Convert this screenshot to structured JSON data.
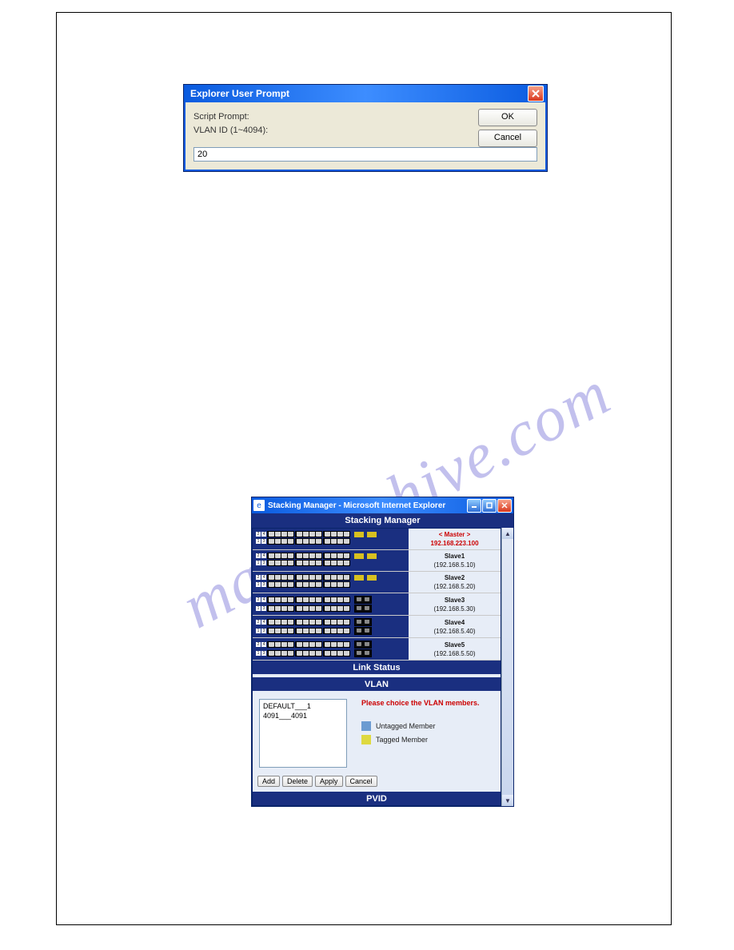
{
  "prompt": {
    "title": "Explorer User Prompt",
    "line1": "Script Prompt:",
    "line2": "VLAN ID (1~4094):",
    "ok": "OK",
    "cancel": "Cancel",
    "value": "20"
  },
  "stacking": {
    "window_title": "Stacking Manager - Microsoft Internet Explorer",
    "header": "Stacking Manager",
    "link_status": "Link Status",
    "vlan_header": "VLAN",
    "pvid_header": "PVID",
    "switches": [
      {
        "name": "< Master >",
        "ip": "192.168.223.100",
        "master": true,
        "sfp": true
      },
      {
        "name": "Slave1",
        "ip": "(192.168.5.10)",
        "master": false,
        "sfp": true
      },
      {
        "name": "Slave2",
        "ip": "(192.168.5.20)",
        "master": false,
        "sfp": true
      },
      {
        "name": "Slave3",
        "ip": "(192.168.5.30)",
        "master": false,
        "sfp": false
      },
      {
        "name": "Slave4",
        "ip": "(192.168.5.40)",
        "master": false,
        "sfp": false
      },
      {
        "name": "Slave5",
        "ip": "(192.168.5.50)",
        "master": false,
        "sfp": false
      }
    ],
    "vlan_list": [
      "DEFAULT___1",
      "4091___4091"
    ],
    "vlan_msg": "Please choice the VLAN members.",
    "legend_untagged": "Untagged Member",
    "legend_tagged": "Tagged Member",
    "legend_color_untagged": "#6b9bd1",
    "legend_color_tagged": "#ded940",
    "buttons": {
      "add": "Add",
      "delete": "Delete",
      "apply": "Apply",
      "cancel": "Cancel"
    }
  },
  "watermark": "manualchive.com"
}
